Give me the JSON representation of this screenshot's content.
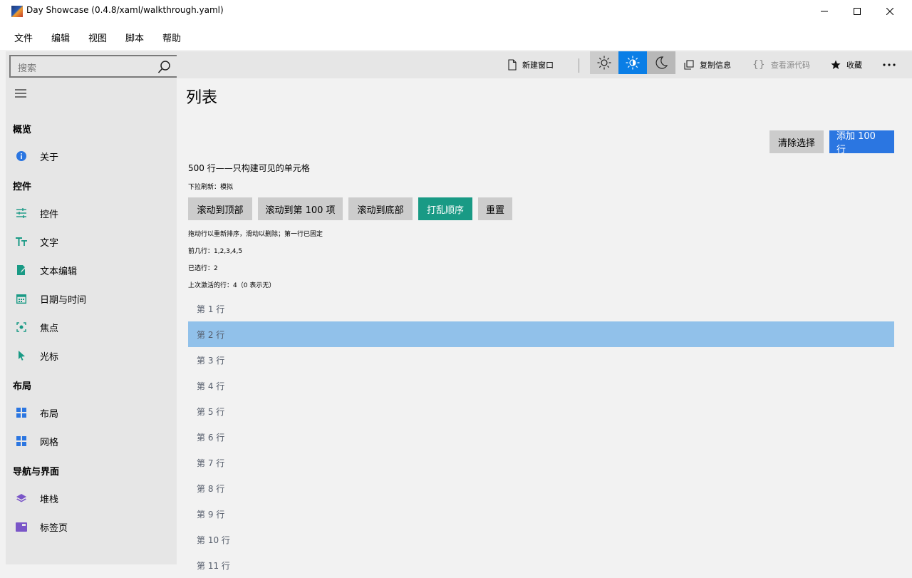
{
  "window": {
    "title": "Day Showcase (0.4.8/xaml/walkthrough.yaml)"
  },
  "menu": [
    "文件",
    "编辑",
    "视图",
    "脚本",
    "帮助"
  ],
  "search": {
    "placeholder": "搜索"
  },
  "sidebar": {
    "sections": [
      "概览",
      "控件",
      "布局",
      "导航与界面"
    ],
    "items": [
      {
        "label": "关于",
        "icon": "info-icon",
        "color": "#2b76e1"
      },
      {
        "label": "控件",
        "icon": "sliders-icon",
        "color": "#199a85"
      },
      {
        "label": "文字",
        "icon": "text-size-icon",
        "color": "#199a85"
      },
      {
        "label": "文本编辑",
        "icon": "edit-icon",
        "color": "#199a85"
      },
      {
        "label": "日期与时间",
        "icon": "calendar-icon",
        "color": "#199a85"
      },
      {
        "label": "焦点",
        "icon": "focus-icon",
        "color": "#199a85"
      },
      {
        "label": "光标",
        "icon": "cursor-icon",
        "color": "#199a85"
      },
      {
        "label": "布局",
        "icon": "grid-icon",
        "color": "#2b76e1"
      },
      {
        "label": "网格",
        "icon": "grid-icon",
        "color": "#2b76e1"
      },
      {
        "label": "堆栈",
        "icon": "layers-icon",
        "color": "#7a56c8"
      },
      {
        "label": "标签页",
        "icon": "tab-icon",
        "color": "#7a56c8"
      }
    ]
  },
  "toolbar": {
    "new_window": "新建窗口",
    "copy_info": "复制信息",
    "view_source": "查看源代码",
    "favorite": "收藏",
    "active_theme": "auto",
    "accent": "#0a7ee6"
  },
  "page": {
    "title": "列表",
    "clear_selection": "清除选择",
    "add_rows": "添加 100 行",
    "description": "500 行——只构建可见的单元格",
    "pull_refresh": "下拉刷新：模拟",
    "buttons": {
      "scroll_top": "滚动到顶部",
      "scroll_100": "滚动到第 100 项",
      "scroll_bottom": "滚动到底部",
      "shuffle": "打乱顺序",
      "reset": "重置"
    },
    "drag_hint": "拖动行以重新排序，滑动以删除；第一行已固定",
    "first_rows": "前几行：1,2,3,4,5",
    "selected": "已选行：2",
    "last_activated": "上次激活的行：4（0 表示无）"
  },
  "rows": [
    "第 1 行",
    "第 2 行",
    "第 3 行",
    "第 4 行",
    "第 5 行",
    "第 6 行",
    "第 7 行",
    "第 8 行",
    "第 9 行",
    "第 10 行",
    "第 11 行"
  ],
  "selected_row_index": 1
}
